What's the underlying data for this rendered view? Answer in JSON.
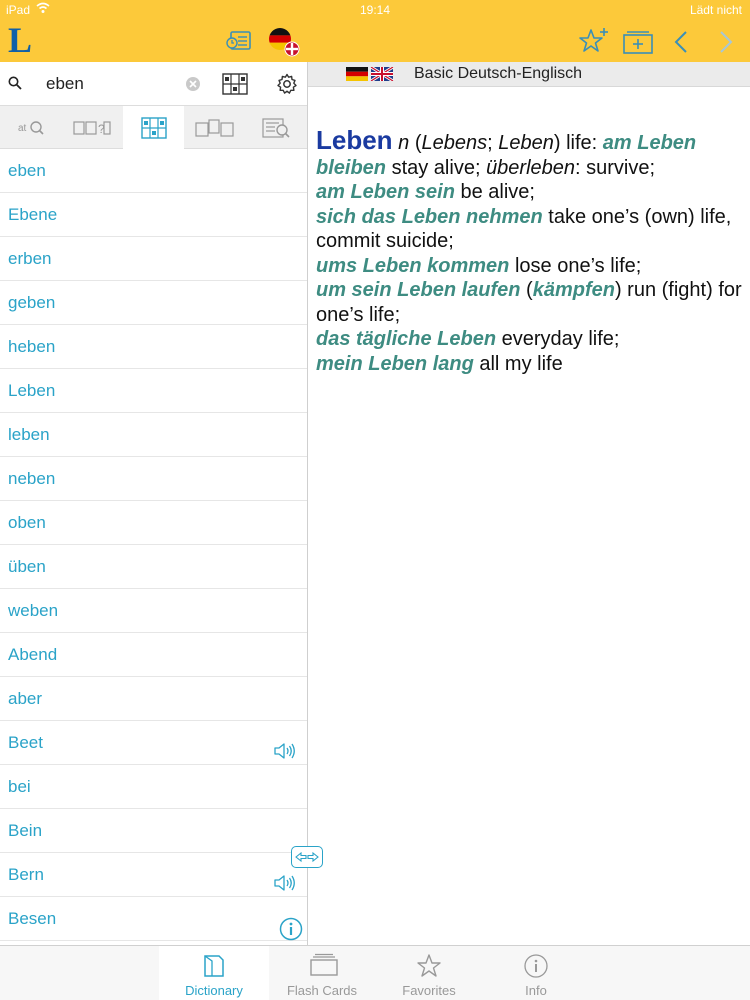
{
  "status_bar": {
    "carrier": "iPad",
    "time": "19:14",
    "battery": "Lädt nicht"
  },
  "toolbar": {
    "logo": "L"
  },
  "search": {
    "value": "eben"
  },
  "dictionary_header": {
    "name": "Basic Deutsch-Englisch"
  },
  "word_list": [
    {
      "word": "eben",
      "audio": false
    },
    {
      "word": "Ebene",
      "audio": false
    },
    {
      "word": "erben",
      "audio": false
    },
    {
      "word": "geben",
      "audio": false
    },
    {
      "word": "heben",
      "audio": false
    },
    {
      "word": "Leben",
      "audio": false
    },
    {
      "word": "leben",
      "audio": false
    },
    {
      "word": "neben",
      "audio": false
    },
    {
      "word": "oben",
      "audio": false
    },
    {
      "word": "üben",
      "audio": false
    },
    {
      "word": "weben",
      "audio": false
    },
    {
      "word": "Abend",
      "audio": false
    },
    {
      "word": "aber",
      "audio": false
    },
    {
      "word": "Beet",
      "audio": true
    },
    {
      "word": "bei",
      "audio": false
    },
    {
      "word": "Bein",
      "audio": false
    },
    {
      "word": "Bern",
      "audio": true
    },
    {
      "word": "Besen",
      "audio": false
    }
  ],
  "entry": {
    "headword": "Leben",
    "pos": "n",
    "forms_open": " (",
    "genitive": "Lebens",
    "sep": "; ",
    "plural": "Leben",
    "forms_close": ") life: ",
    "lines": [
      {
        "ex": "am Leben bleiben",
        "tr": " stay alive; ",
        "alt": "überleben",
        "tr2": ": survive;"
      },
      {
        "ex": "am Leben sein",
        "tr": " be alive;"
      },
      {
        "ex": "sich das Leben nehmen",
        "tr": " take one’s (own) life, commit suicide;"
      },
      {
        "ex": "ums Leben kommen",
        "tr": " lose one’s life;"
      },
      {
        "ex": "um sein Leben laufen",
        "tr": " (",
        "ex2": "kämpfen",
        "tr2": ") run (fight) for one’s life;"
      },
      {
        "ex": "das tägliche Leben",
        "tr": " everyday life;"
      },
      {
        "ex": "mein Leben lang",
        "tr": " all my life"
      }
    ]
  },
  "tabs": [
    {
      "label": "Dictionary",
      "icon": "book-icon",
      "active": true
    },
    {
      "label": "Flash Cards",
      "icon": "flashcards-icon",
      "active": false
    },
    {
      "label": "Favorites",
      "icon": "star-icon",
      "active": false
    },
    {
      "label": "Info",
      "icon": "info-icon",
      "active": false
    }
  ],
  "colors": {
    "toolbar": "#fcc93a",
    "accent": "#2aa3c8",
    "headword": "#1a3aa0",
    "example": "#3e8c82"
  }
}
